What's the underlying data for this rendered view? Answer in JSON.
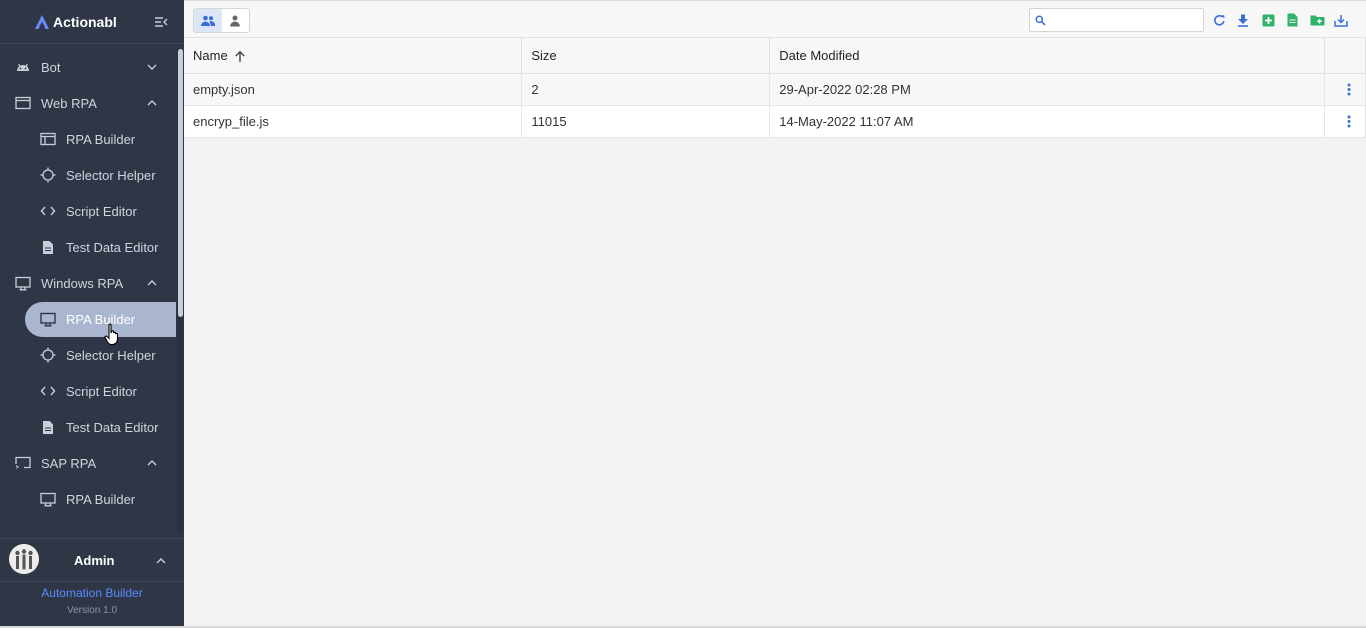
{
  "app": {
    "brand": "Actionabl"
  },
  "sidebar": {
    "items": [
      {
        "key": "bot",
        "label": "Bot",
        "type": "group",
        "icon": "android-icon",
        "expanded": false
      },
      {
        "key": "web-rpa",
        "label": "Web RPA",
        "type": "group",
        "icon": "browser-window-icon",
        "expanded": true
      },
      {
        "key": "web-rpa-builder",
        "label": "RPA Builder",
        "type": "child",
        "icon": "browser-window-icon"
      },
      {
        "key": "web-selector-helper",
        "label": "Selector Helper",
        "type": "child",
        "icon": "crosshair-icon"
      },
      {
        "key": "web-script-editor",
        "label": "Script Editor",
        "type": "child",
        "icon": "code-icon"
      },
      {
        "key": "web-test-data-editor",
        "label": "Test Data Editor",
        "type": "child",
        "icon": "document-icon"
      },
      {
        "key": "windows-rpa",
        "label": "Windows RPA",
        "type": "group",
        "icon": "monitor-icon",
        "expanded": true
      },
      {
        "key": "win-rpa-builder",
        "label": "RPA Builder",
        "type": "child",
        "icon": "monitor-icon",
        "active": true
      },
      {
        "key": "win-selector-helper",
        "label": "Selector Helper",
        "type": "child",
        "icon": "crosshair-icon"
      },
      {
        "key": "win-script-editor",
        "label": "Script Editor",
        "type": "child",
        "icon": "code-icon"
      },
      {
        "key": "win-test-data-editor",
        "label": "Test Data Editor",
        "type": "child",
        "icon": "document-icon"
      },
      {
        "key": "sap-rpa",
        "label": "SAP RPA",
        "type": "group",
        "icon": "cast-icon",
        "expanded": true
      },
      {
        "key": "sap-rpa-builder",
        "label": "RPA Builder",
        "type": "child",
        "icon": "cast-icon"
      }
    ]
  },
  "user": {
    "name": "Admin"
  },
  "footer": {
    "title": "Automation Builder",
    "version": "Version 1.0"
  },
  "toolbar": {
    "search_placeholder": "",
    "actions": [
      "refresh-icon",
      "download-icon",
      "add-box-icon",
      "file-icon",
      "add-folder-icon",
      "import-icon"
    ]
  },
  "table": {
    "headers": {
      "name": "Name",
      "size": "Size",
      "date": "Date Modified"
    },
    "sort": {
      "column": "Name",
      "direction": "ascending"
    },
    "rows": [
      {
        "name": "empty.json",
        "size": "2",
        "date": "29-Apr-2022 02:28 PM"
      },
      {
        "name": "encryp_file.js",
        "size": "11015",
        "date": "14-May-2022 11:07 AM"
      }
    ]
  },
  "colors": {
    "sidebar_bg": "#2f3747",
    "active_pill": "#aab5cf",
    "accent": "#3b6fd8",
    "green": "#2fb36b",
    "footer_link": "#5a8cff"
  }
}
